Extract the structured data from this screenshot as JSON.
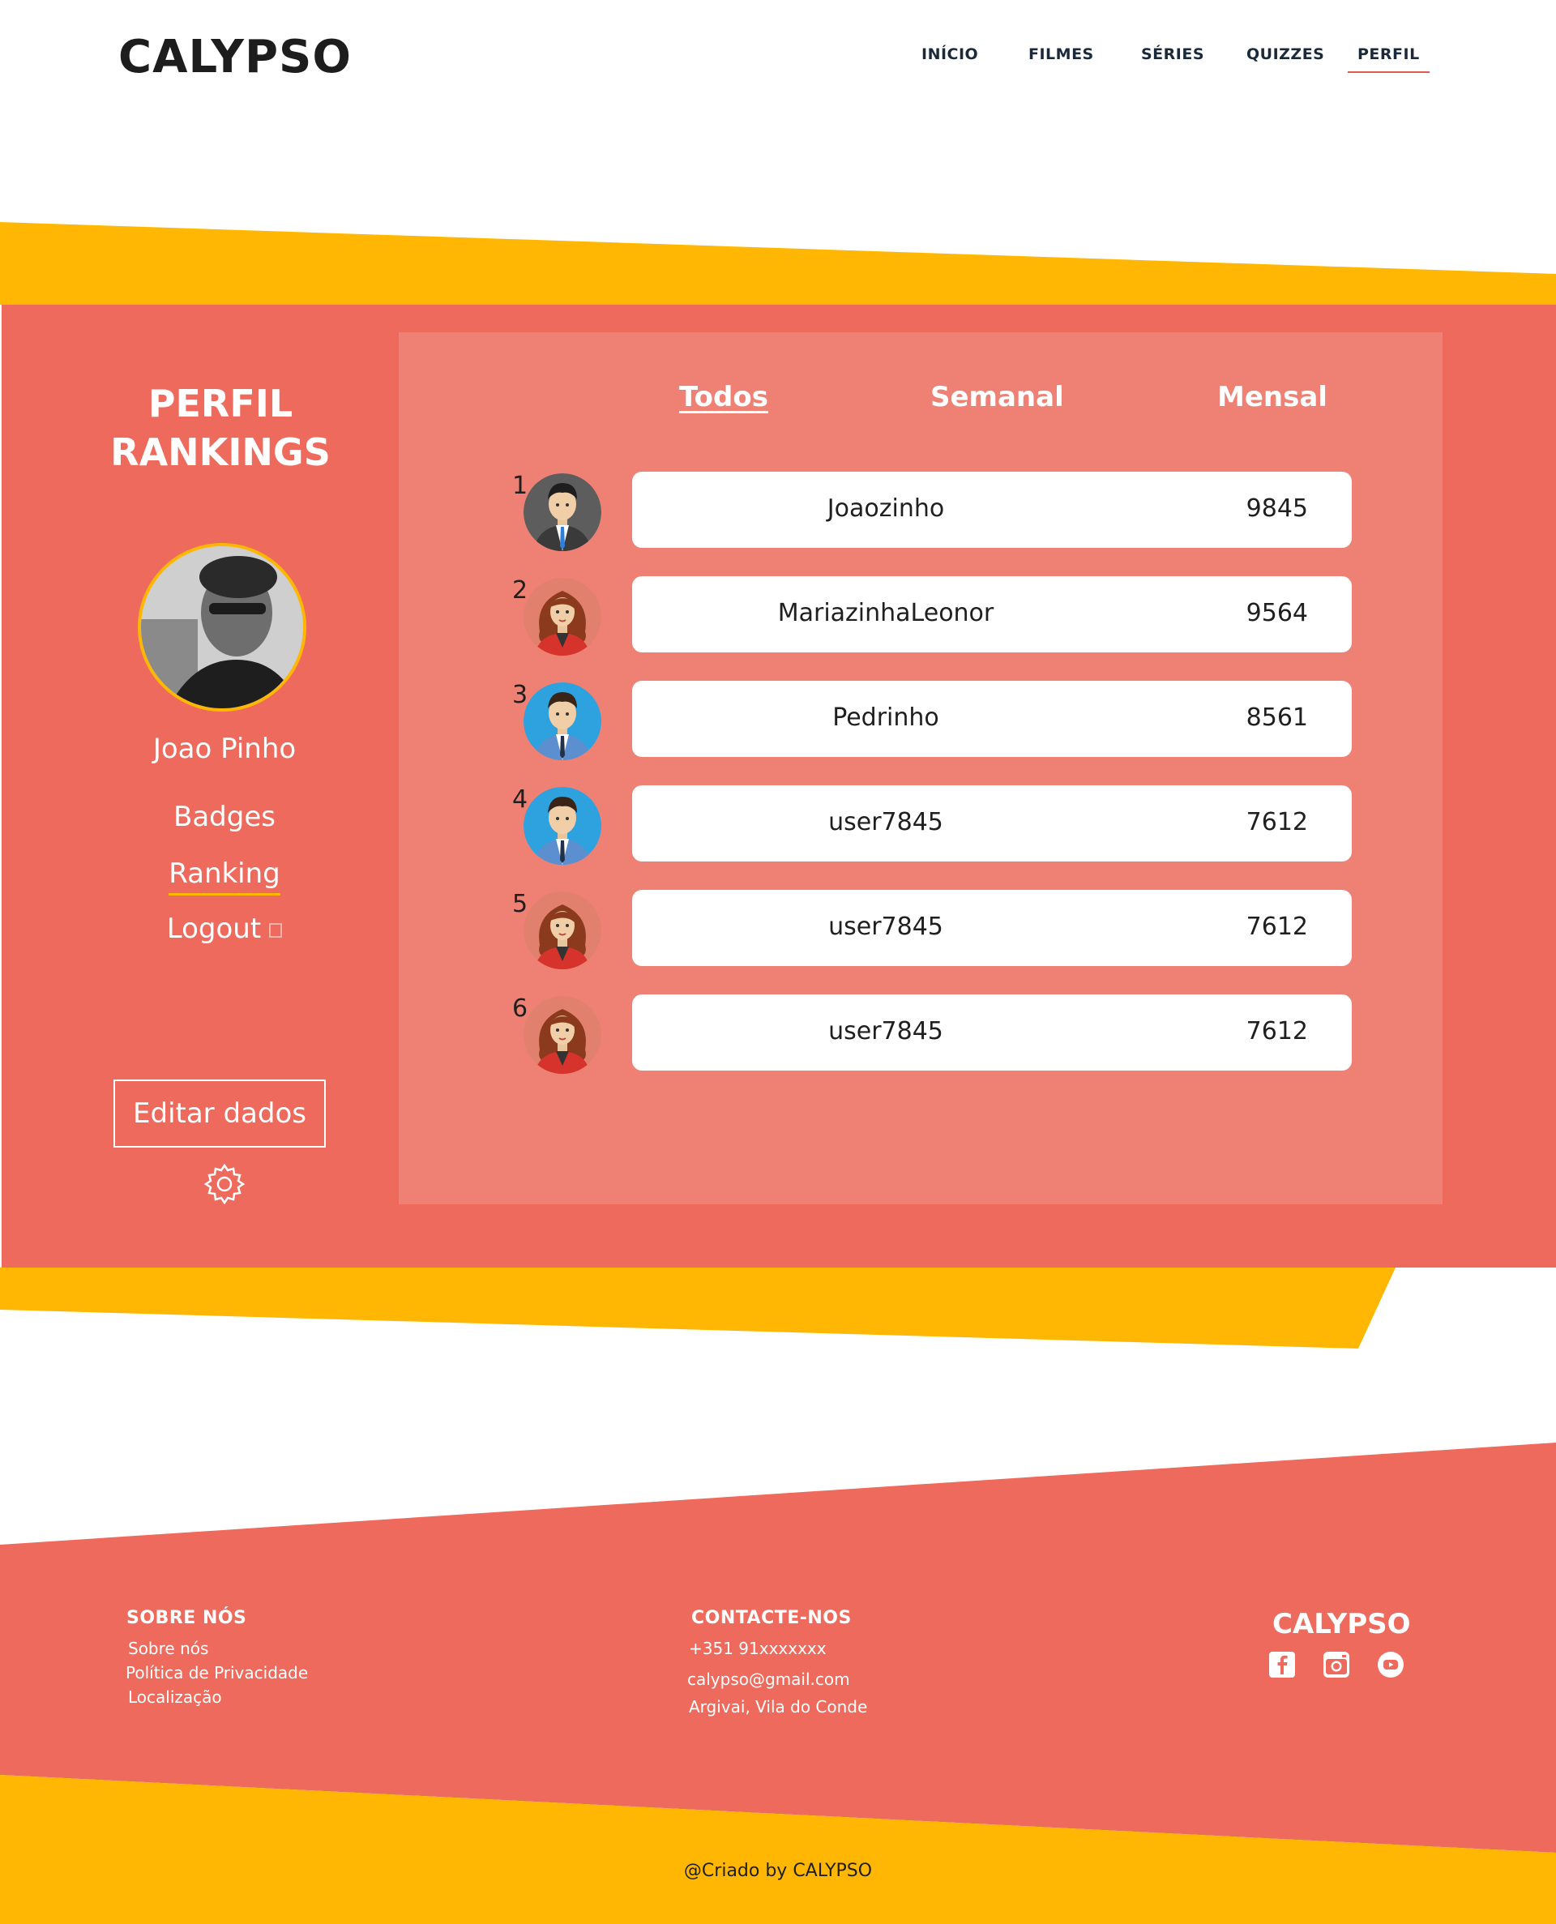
{
  "header": {
    "logo": "CALYPSO",
    "nav": [
      "INÍCIO",
      "FILMES",
      "SÉRIES",
      "QUIZZES",
      "PERFIL"
    ],
    "active_nav": "PERFIL"
  },
  "sidebar": {
    "title_line1": "PERFIL",
    "title_line2": "RANKINGS",
    "user_name": "Joao Pinho",
    "links": {
      "badges": "Badges",
      "ranking": "Ranking",
      "logout": "Logout"
    },
    "edit_button": "Editar dados"
  },
  "ranking": {
    "tabs": {
      "todos": "Todos",
      "semanal": "Semanal",
      "mensal": "Mensal"
    },
    "active_tab": "Todos",
    "rows": [
      {
        "rank": "1",
        "name": "Joaozinho",
        "score": "9845",
        "avatar": "man-suit-dark-avatar"
      },
      {
        "rank": "2",
        "name": "MariazinhaLeonor",
        "score": "9564",
        "avatar": "woman-red-avatar"
      },
      {
        "rank": "3",
        "name": "Pedrinho",
        "score": "8561",
        "avatar": "man-blue-avatar"
      },
      {
        "rank": "4",
        "name": "user7845",
        "score": "7612",
        "avatar": "man-blue-avatar"
      },
      {
        "rank": "5",
        "name": "user7845",
        "score": "7612",
        "avatar": "woman-red-avatar"
      },
      {
        "rank": "6",
        "name": "user7845",
        "score": "7612",
        "avatar": "woman-red-avatar"
      }
    ]
  },
  "footer": {
    "about_title": "SOBRE NÓS",
    "about_links": [
      "Sobre nós",
      "Política de Privacidade",
      "Localização"
    ],
    "contact_title": "CONTACTE-NOS",
    "phone": "+351 91xxxxxxx",
    "email": "calypso@gmail.com",
    "address": "Argivai, Vila do Conde",
    "brand": "CALYPSO",
    "social_icons": [
      "facebook-icon",
      "instagram-icon",
      "youtube-icon"
    ],
    "copyright": "@Criado by CALYPSO"
  },
  "colors": {
    "coral": "#ee6a5c",
    "coral_light": "#ee8174",
    "yellow": "#ffb703"
  }
}
